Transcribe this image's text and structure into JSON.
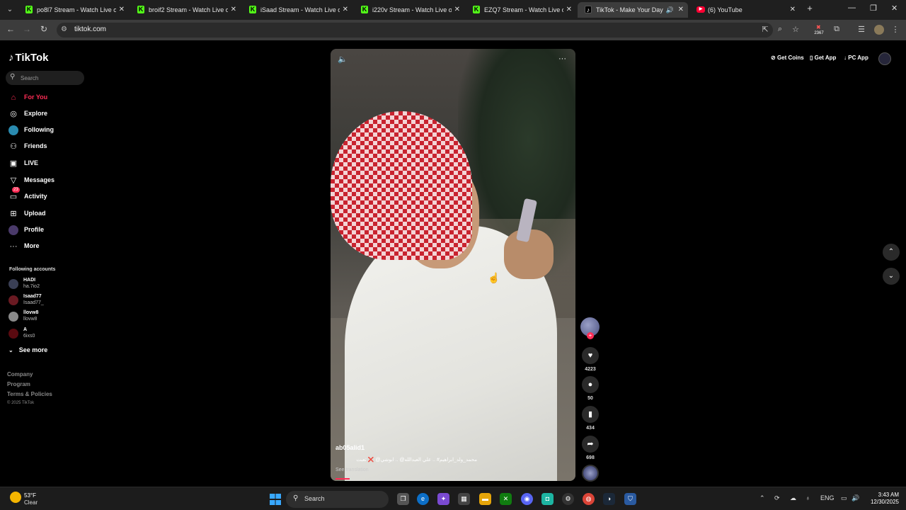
{
  "browser": {
    "tabs": [
      {
        "title": "po8l7 Stream - Watch Live on K",
        "favicon": "K"
      },
      {
        "title": "broif2 Stream - Watch Live on K",
        "favicon": "K"
      },
      {
        "title": "iSaad Stream - Watch Live on K",
        "favicon": "K"
      },
      {
        "title": "i220v Stream - Watch Live on K",
        "favicon": "K"
      },
      {
        "title": "EZQ7 Stream - Watch Live on K",
        "favicon": "K"
      },
      {
        "title": "TikTok - Make Your Day",
        "favicon": "♪"
      },
      {
        "title": "(6) YouTube",
        "favicon": "▶"
      }
    ],
    "url": "tiktok.com",
    "extension_badge": "2367"
  },
  "tiktok": {
    "logo": "TikTok",
    "search_placeholder": "Search",
    "nav": [
      {
        "label": "For You",
        "icon": "home-icon"
      },
      {
        "label": "Explore",
        "icon": "compass-icon"
      },
      {
        "label": "Following",
        "icon": "following-icon"
      },
      {
        "label": "Friends",
        "icon": "friends-icon"
      },
      {
        "label": "LIVE",
        "icon": "live-icon"
      },
      {
        "label": "Messages",
        "icon": "send-icon"
      },
      {
        "label": "Activity",
        "icon": "inbox-icon",
        "badge": "23"
      },
      {
        "label": "Upload",
        "icon": "plus-square-icon"
      },
      {
        "label": "Profile",
        "icon": "profile-icon"
      },
      {
        "label": "More",
        "icon": "more-icon"
      }
    ],
    "following_title": "Following accounts",
    "accounts": [
      {
        "name": "HADI",
        "handle": "ha.7io2"
      },
      {
        "name": "Isaad77",
        "handle": "Isaad77_"
      },
      {
        "name": "llovw8",
        "handle": "llovw8"
      },
      {
        "name": "A",
        "handle": "6ixs0"
      }
    ],
    "see_more": "See more",
    "footer": [
      "Company",
      "Program",
      "Terms & Policies"
    ],
    "copyright": "© 2025 TikTok",
    "top_links": [
      "Get Coins",
      "Get App",
      "PC App"
    ],
    "video": {
      "username": "ab05alid1",
      "caption": "محمد_ولد_ابراهيم# .. علي العبدالله@ .. ابوشي@ ❌ تعبت",
      "see_translation": "See translation"
    },
    "actions": {
      "likes": "4223",
      "comments": "50",
      "saves": "434",
      "shares": "698"
    }
  },
  "taskbar": {
    "temperature": "53°F",
    "weather": "Clear",
    "search": "Search",
    "language": "ENG",
    "time": "3:43 AM",
    "date": "12/30/2025"
  },
  "colors": {
    "accent": "#fe2c55",
    "kick_green": "#53fc18"
  }
}
